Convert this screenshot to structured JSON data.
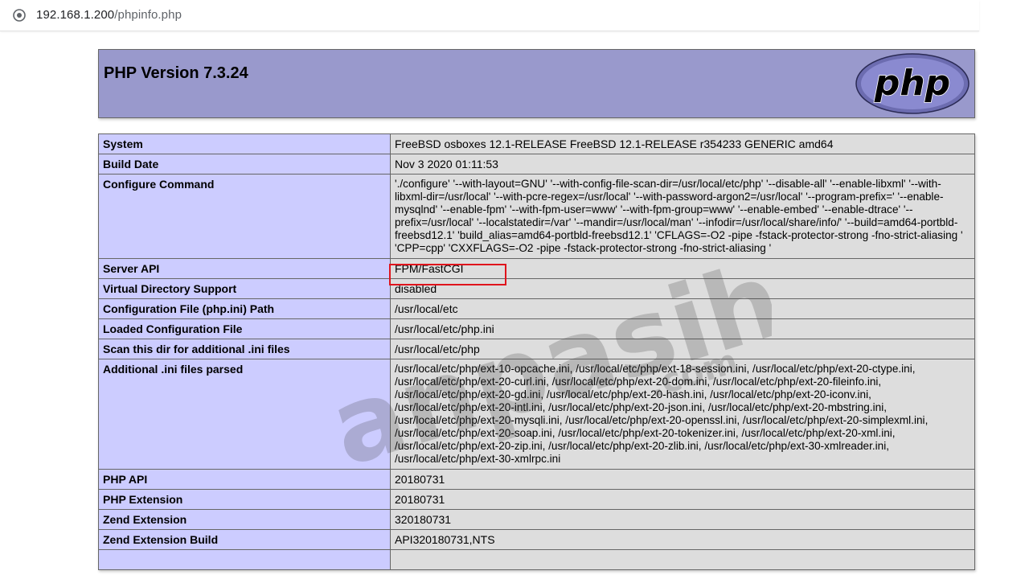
{
  "browser": {
    "url_host": "192.168.1.200",
    "url_path": "/phpinfo.php",
    "site_icon": "globe-icon"
  },
  "header": {
    "title": "PHP Version 7.3.24",
    "logo": "php-logo"
  },
  "table": {
    "rows": [
      {
        "key": "System",
        "value": "FreeBSD osboxes 12.1-RELEASE FreeBSD 12.1-RELEASE r354233 GENERIC amd64"
      },
      {
        "key": "Build Date",
        "value": "Nov 3 2020 01:11:53"
      },
      {
        "key": "Configure Command",
        "value": "'./configure' '--with-layout=GNU' '--with-config-file-scan-dir=/usr/local/etc/php' '--disable-all' '--enable-libxml' '--with-libxml-dir=/usr/local' '--with-pcre-regex=/usr/local' '--with-password-argon2=/usr/local' '--program-prefix=' '--enable-mysqlnd' '--enable-fpm' '--with-fpm-user=www' '--with-fpm-group=www' '--enable-embed' '--enable-dtrace' '--prefix=/usr/local' '--localstatedir=/var' '--mandir=/usr/local/man' '--infodir=/usr/local/share/info/' '--build=amd64-portbld-freebsd12.1' 'build_alias=amd64-portbld-freebsd12.1' 'CFLAGS=-O2 -pipe -fstack-protector-strong -fno-strict-aliasing ' 'CPP=cpp' 'CXXFLAGS=-O2 -pipe -fstack-protector-strong -fno-strict-aliasing '"
      },
      {
        "key": "Server API",
        "value": "FPM/FastCGI"
      },
      {
        "key": "Virtual Directory Support",
        "value": "disabled"
      },
      {
        "key": "Configuration File (php.ini) Path",
        "value": "/usr/local/etc"
      },
      {
        "key": "Loaded Configuration File",
        "value": "/usr/local/etc/php.ini"
      },
      {
        "key": "Scan this dir for additional .ini files",
        "value": "/usr/local/etc/php"
      },
      {
        "key": "Additional .ini files parsed",
        "value": "/usr/local/etc/php/ext-10-opcache.ini, /usr/local/etc/php/ext-18-session.ini, /usr/local/etc/php/ext-20-ctype.ini, /usr/local/etc/php/ext-20-curl.ini, /usr/local/etc/php/ext-20-dom.ini, /usr/local/etc/php/ext-20-fileinfo.ini, /usr/local/etc/php/ext-20-gd.ini, /usr/local/etc/php/ext-20-hash.ini, /usr/local/etc/php/ext-20-iconv.ini, /usr/local/etc/php/ext-20-intl.ini, /usr/local/etc/php/ext-20-json.ini, /usr/local/etc/php/ext-20-mbstring.ini, /usr/local/etc/php/ext-20-mysqli.ini, /usr/local/etc/php/ext-20-openssl.ini, /usr/local/etc/php/ext-20-simplexml.ini, /usr/local/etc/php/ext-20-soap.ini, /usr/local/etc/php/ext-20-tokenizer.ini, /usr/local/etc/php/ext-20-xml.ini, /usr/local/etc/php/ext-20-zip.ini, /usr/local/etc/php/ext-20-zlib.ini, /usr/local/etc/php/ext-30-xmlreader.ini, /usr/local/etc/php/ext-30-xmlrpc.ini"
      },
      {
        "key": "PHP API",
        "value": "20180731"
      },
      {
        "key": "PHP Extension",
        "value": "20180731"
      },
      {
        "key": "Zend Extension",
        "value": "320180731"
      },
      {
        "key": "Zend Extension Build",
        "value": "API320180731,NTS"
      },
      {
        "key": "",
        "value": ""
      }
    ]
  },
  "watermark": {
    "brand": "anpasih",
    "domain": ".com",
    "tagline": "Situs"
  },
  "colors": {
    "header_bg": "#9999cc",
    "key_bg": "#ccccff",
    "value_bg": "#dddddd",
    "highlight": "#e0141c"
  }
}
